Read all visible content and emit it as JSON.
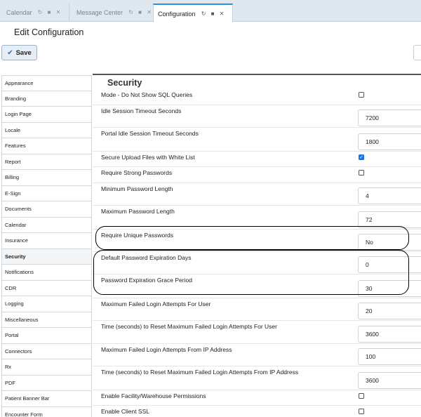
{
  "tabs": [
    {
      "label": "Calendar"
    },
    {
      "label": "Message Center"
    },
    {
      "label": "Configuration"
    }
  ],
  "icons": {
    "refresh": "refresh-icon",
    "lock": "lock-icon",
    "close": "close-icon",
    "check": "checkmark-icon"
  },
  "header": {
    "title": "Edit Configuration",
    "save_label": "Save"
  },
  "sidebar": {
    "items": [
      {
        "label": "Appearance"
      },
      {
        "label": "Branding"
      },
      {
        "label": "Login Page"
      },
      {
        "label": "Locale"
      },
      {
        "label": "Features"
      },
      {
        "label": "Report"
      },
      {
        "label": "Billing"
      },
      {
        "label": "E-Sign"
      },
      {
        "label": "Documents"
      },
      {
        "label": "Calendar"
      },
      {
        "label": "Insurance"
      },
      {
        "label": "Security",
        "active": true
      },
      {
        "label": "Notifications"
      },
      {
        "label": "CDR"
      },
      {
        "label": "Logging"
      },
      {
        "label": "Miscellaneous"
      },
      {
        "label": "Portal"
      },
      {
        "label": "Connectors"
      },
      {
        "label": "Rx"
      },
      {
        "label": "PDF"
      },
      {
        "label": "Patient Banner Bar"
      },
      {
        "label": "Encounter Form"
      }
    ]
  },
  "section": {
    "title": "Security"
  },
  "settings": [
    {
      "label": "Mode - Do Not Show SQL Queries",
      "type": "checkbox",
      "checked": false
    },
    {
      "label": "Idle Session Timeout Seconds",
      "type": "input",
      "value": "7200"
    },
    {
      "label": "Portal Idle Session Timeout Seconds",
      "type": "input",
      "value": "1800"
    },
    {
      "label": "Secure Upload Files with White List",
      "type": "checkbox",
      "checked": true
    },
    {
      "label": "Require Strong Passwords",
      "type": "checkbox",
      "checked": false
    },
    {
      "label": "Minimum Password Length",
      "type": "input",
      "value": "4"
    },
    {
      "label": "Maximum Password Length",
      "type": "input",
      "value": "72"
    },
    {
      "label": "Require Unique Passwords",
      "type": "input",
      "value": "No"
    },
    {
      "label": "Default Password Expiration Days",
      "type": "input",
      "value": "0"
    },
    {
      "label": "Password Expiration Grace Period",
      "type": "input",
      "value": "30"
    },
    {
      "label": "Maximum Failed Login Attempts For User",
      "type": "input",
      "value": "20"
    },
    {
      "label": "Time (seconds) to Reset Maximum Failed Login Attempts For User",
      "type": "input",
      "value": "3600"
    },
    {
      "label": "Maximum Failed Login Attempts From IP Address",
      "type": "input",
      "value": "100"
    },
    {
      "label": "Time (seconds) to Reset Maximum Failed Login Attempts From IP Address",
      "type": "input",
      "value": "3600"
    },
    {
      "label": "Enable Facility/Warehouse Permissions",
      "type": "checkbox",
      "checked": false
    },
    {
      "label": "Enable Client SSL",
      "type": "checkbox",
      "checked": false
    }
  ]
}
